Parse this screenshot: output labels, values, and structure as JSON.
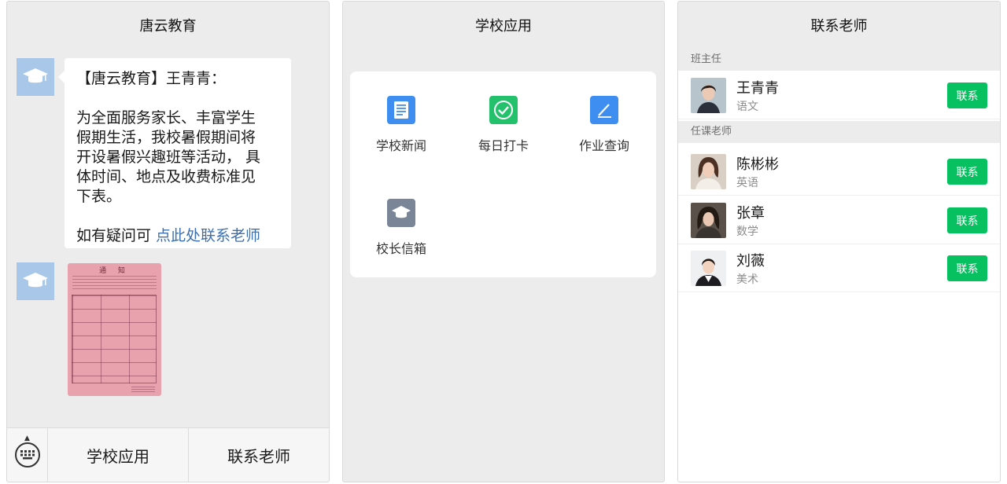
{
  "panel_chat": {
    "title": "唐云教育",
    "message": {
      "line1": "【唐云教育】王青青：",
      "line2": "为全面服务家长、丰富学生",
      "line3": "假期生活，我校暑假期间将",
      "line4": "开设暑假兴趣班等活动， 具",
      "line5": "体时间、地点及收费标准见",
      "line6": "下表。",
      "contact_prefix": "如有疑问可 ",
      "contact_link": "点此处联系老师"
    },
    "notice_title": "通 知",
    "bottom_bar": {
      "btn_school_apps": "学校应用",
      "btn_contact_teacher": "联系老师"
    }
  },
  "panel_apps": {
    "title": "学校应用",
    "apps": [
      {
        "label": "学校新闻",
        "icon": "news-icon",
        "color": "#3d8ef0"
      },
      {
        "label": "每日打卡",
        "icon": "checkin-icon",
        "color": "#23c16b"
      },
      {
        "label": "作业查询",
        "icon": "pen-icon",
        "color": "#3d8ef0"
      },
      {
        "label": "校长信箱",
        "icon": "mortarboard-icon",
        "color": "#7a8597"
      }
    ]
  },
  "panel_contacts": {
    "title": "联系老师",
    "section_head": "班主任",
    "section_subject": "任课老师",
    "button_label": "联系",
    "head_teacher": {
      "name": "王青青",
      "subject": "语文"
    },
    "teachers": [
      {
        "name": "陈彬彬",
        "subject": "英语"
      },
      {
        "name": "张章",
        "subject": "数学"
      },
      {
        "name": "刘薇",
        "subject": "美术"
      }
    ]
  },
  "colors": {
    "accent_green": "#07c160",
    "link_blue": "#3c6fb0",
    "avatar_blue": "#a9c7e8"
  }
}
